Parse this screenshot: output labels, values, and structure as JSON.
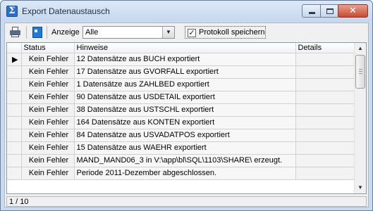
{
  "window": {
    "title": "Export Datenaustausch",
    "icon": "sigma-icon",
    "close_glyph": "✕"
  },
  "toolbar": {
    "anzeige_label": "Anzeige",
    "anzeige_value": "Alle",
    "protokoll_label": "Protokoll speichern",
    "protokoll_checked": true
  },
  "grid": {
    "columns": [
      "Status",
      "Hinweise",
      "Details"
    ],
    "rows": [
      {
        "status": "Kein Fehler",
        "hinweis": "12 Datensätze aus BUCH exportiert",
        "details": ""
      },
      {
        "status": "Kein Fehler",
        "hinweis": "17 Datensätze aus GVORFALL exportiert",
        "details": ""
      },
      {
        "status": "Kein Fehler",
        "hinweis": "1 Datensätze aus ZAHLBED exportiert",
        "details": ""
      },
      {
        "status": "Kein Fehler",
        "hinweis": "90 Datensätze aus USDETAIL exportiert",
        "details": ""
      },
      {
        "status": "Kein Fehler",
        "hinweis": "38 Datensätze aus USTSCHL exportiert",
        "details": ""
      },
      {
        "status": "Kein Fehler",
        "hinweis": "164 Datensätze aus KONTEN exportiert",
        "details": ""
      },
      {
        "status": "Kein Fehler",
        "hinweis": "84 Datensätze aus USVADATPOS exportiert",
        "details": ""
      },
      {
        "status": "Kein Fehler",
        "hinweis": "15 Datensätze aus WAEHR exportiert",
        "details": ""
      },
      {
        "status": "Kein Fehler",
        "hinweis": "MAND_MAND06_3 in V:\\app\\bl\\SQL\\1103\\SHARE\\ erzeugt.",
        "details": ""
      },
      {
        "status": "Kein Fehler",
        "hinweis": "Periode 2011-Dezember abgeschlossen.",
        "details": ""
      }
    ]
  },
  "status": {
    "page": "1 / 10"
  }
}
